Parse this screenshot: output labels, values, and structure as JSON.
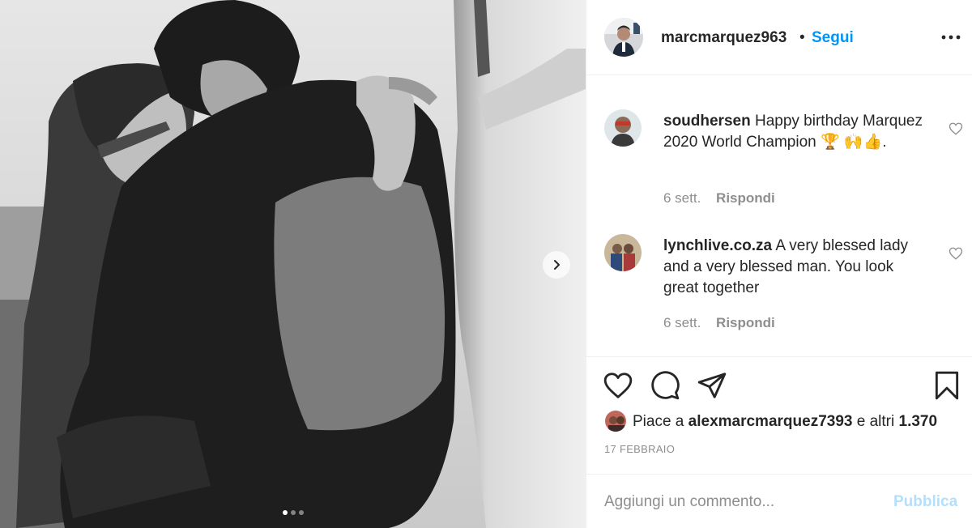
{
  "post": {
    "image_alt": "Black and white photo of a couple embracing next to a white wall",
    "carousel": {
      "slide_count": 3,
      "active_index": 0,
      "next_icon": "chevron-right-icon"
    }
  },
  "header": {
    "username": "marcmarquez963",
    "separator": "•",
    "follow_label": "Segui",
    "more_icon": "more-options-icon"
  },
  "comments": [
    {
      "username": "soudhersen",
      "text": "Happy birthday Marquez 2020 World Champion 🏆 🙌👍.",
      "time": "6 sett.",
      "reply_label": "Rispondi"
    },
    {
      "username": "lynchlive.co.za",
      "text": "A very blessed lady and a very blessed man. You look great together",
      "time": "6 sett.",
      "reply_label": "Rispondi"
    }
  ],
  "actions": {
    "icons": [
      "heart-icon",
      "comment-icon",
      "share-icon",
      "bookmark-icon"
    ]
  },
  "likes": {
    "prefix": "Piace a",
    "user": "alexmarcmarquez7393",
    "suffix": "e altri",
    "count": "1.370"
  },
  "date": "17 FEBBRAIO",
  "add_comment": {
    "placeholder": "Aggiungi un commento...",
    "publish_label": "Pubblica"
  },
  "colors": {
    "link_blue": "#0095f6",
    "publish_disabled": "#b2dffc",
    "secondary_text": "#8e8e8e",
    "divider": "#efefef"
  }
}
